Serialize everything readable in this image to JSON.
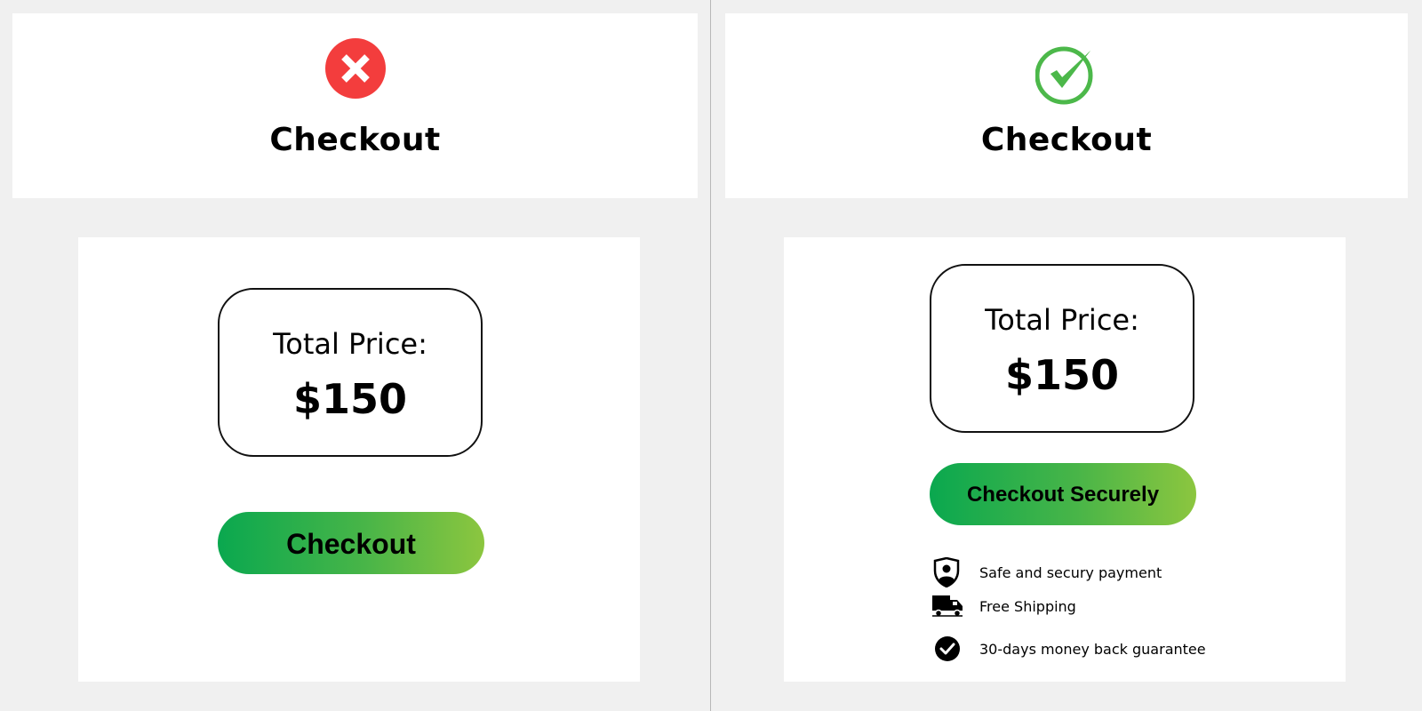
{
  "left_panel": {
    "status_icon": "x-circle-icon",
    "status_color": "#f33d3d",
    "title": "Checkout",
    "price_label": "Total Price:",
    "price_value": "$150",
    "button_label": "Checkout"
  },
  "right_panel": {
    "status_icon": "check-circle-icon",
    "status_color": "#4cb84a",
    "title": "Checkout",
    "price_label": "Total Price:",
    "price_value": "$150",
    "button_label": "Checkout Securely",
    "features": [
      {
        "icon": "shield-user-icon",
        "text": "Safe and secury payment"
      },
      {
        "icon": "truck-icon",
        "text": "Free Shipping"
      },
      {
        "icon": "check-badge-icon",
        "text": "30-days money back guarantee"
      }
    ]
  },
  "colors": {
    "button_gradient_start": "#0aa84f",
    "button_gradient_end": "#8cc63f",
    "background": "#f0f0f0"
  }
}
